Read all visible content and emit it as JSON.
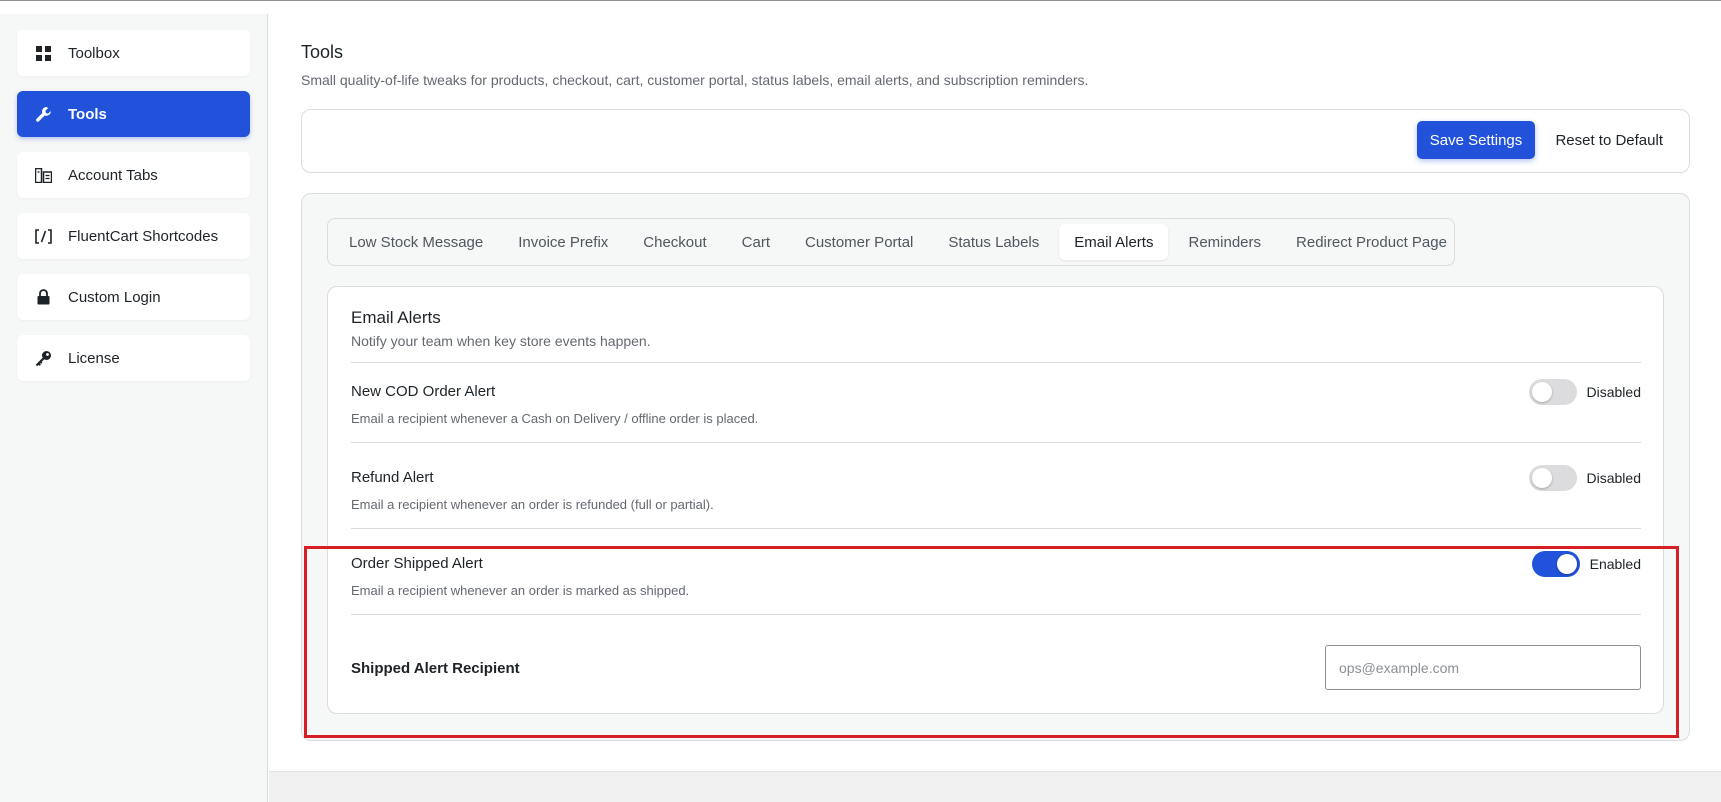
{
  "sidebar": {
    "items": [
      {
        "label": "Toolbox",
        "icon": "grid-icon",
        "active": false
      },
      {
        "label": "Tools",
        "icon": "wrench-icon",
        "active": true
      },
      {
        "label": "Account Tabs",
        "icon": "account-tabs-icon",
        "active": false
      },
      {
        "label": "FluentCart Shortcodes",
        "icon": "shortcode-icon",
        "active": false
      },
      {
        "label": "Custom Login",
        "icon": "lock-icon",
        "active": false
      },
      {
        "label": "License",
        "icon": "key-icon",
        "active": false
      }
    ]
  },
  "header": {
    "title": "Tools",
    "description": "Small quality-of-life tweaks for products, checkout, cart, customer portal, status labels, email alerts, and subscription reminders."
  },
  "actions": {
    "save_label": "Save Settings",
    "reset_label": "Reset to Default"
  },
  "tabs": [
    {
      "label": "Low Stock Message",
      "active": false
    },
    {
      "label": "Invoice Prefix",
      "active": false
    },
    {
      "label": "Checkout",
      "active": false
    },
    {
      "label": "Cart",
      "active": false
    },
    {
      "label": "Customer Portal",
      "active": false
    },
    {
      "label": "Status Labels",
      "active": false
    },
    {
      "label": "Email Alerts",
      "active": true
    },
    {
      "label": "Reminders",
      "active": false
    },
    {
      "label": "Redirect Product Page",
      "active": false
    }
  ],
  "panel": {
    "title": "Email Alerts",
    "description": "Notify your team when key store events happen.",
    "alerts": [
      {
        "title": "New COD Order Alert",
        "description": "Email a recipient whenever a Cash on Delivery / offline order is placed.",
        "status": "Disabled",
        "enabled": false
      },
      {
        "title": "Refund Alert",
        "description": "Email a recipient whenever an order is refunded (full or partial).",
        "status": "Disabled",
        "enabled": false
      },
      {
        "title": "Order Shipped Alert",
        "description": "Email a recipient whenever an order is marked as shipped.",
        "status": "Enabled",
        "enabled": true
      }
    ],
    "recipient": {
      "label": "Shipped Alert Recipient",
      "value": "",
      "placeholder": "ops@example.com"
    }
  },
  "colors": {
    "accent": "#2152d9",
    "highlight": "#d61f26"
  }
}
